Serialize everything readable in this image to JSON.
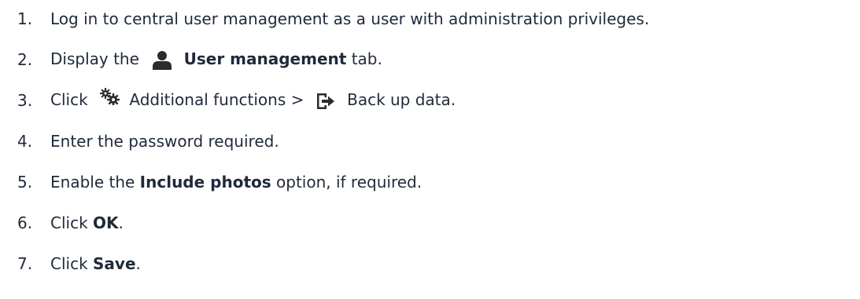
{
  "steps": [
    {
      "number": "1.",
      "text": "Log in to central user management as a user with administration privileges."
    },
    {
      "number": "2.",
      "before": "Display the",
      "icon": "user-icon",
      "bold": "User management",
      "after": "tab."
    },
    {
      "number": "3.",
      "before": "Click",
      "icon1": "gears-icon",
      "mid": "Additional functions >",
      "icon2": "export-icon",
      "after": "Back up data."
    },
    {
      "number": "4.",
      "text": "Enter the password required."
    },
    {
      "number": "5.",
      "before": "Enable the",
      "bold": "Include photos",
      "after": "option, if required."
    },
    {
      "number": "6.",
      "before": "Click",
      "bold": "OK",
      "after": "."
    },
    {
      "number": "7.",
      "before": "Click",
      "bold": "Save",
      "after": "."
    }
  ],
  "colors": {
    "text": "#1f2a3a",
    "icon": "#2b2b2b"
  }
}
